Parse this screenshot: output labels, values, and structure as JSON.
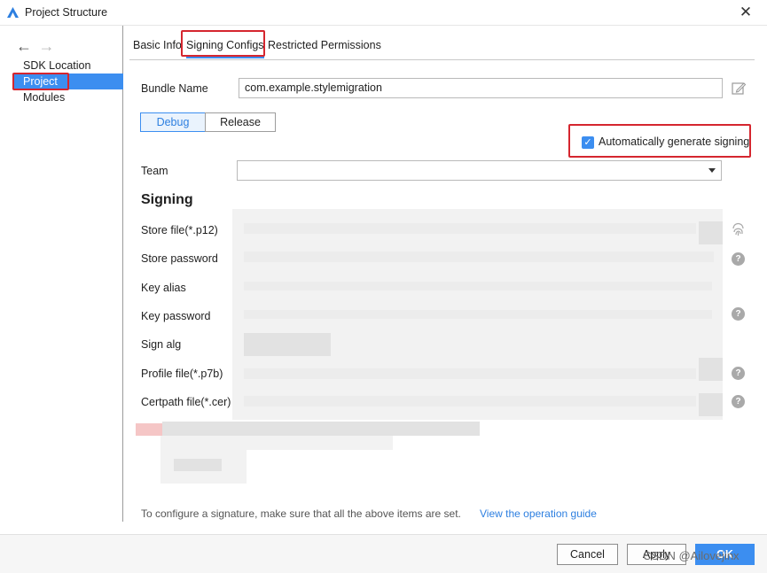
{
  "window": {
    "title": "Project Structure",
    "close_glyph": "✕"
  },
  "sidebar": {
    "back_glyph": "←",
    "forward_glyph": "→",
    "items": [
      {
        "label": "SDK Location"
      },
      {
        "label": "Project",
        "selected": true
      },
      {
        "label": "Modules"
      }
    ]
  },
  "tabs": [
    {
      "label": "Basic Info"
    },
    {
      "label": "Signing Configs",
      "active": true
    },
    {
      "label": "Restricted Permissions"
    }
  ],
  "bundle": {
    "label": "Bundle Name",
    "value": "com.example.stylemigration"
  },
  "modes": {
    "debug": "Debug",
    "release": "Release",
    "active": "Debug"
  },
  "auto_sign": {
    "label": "Automatically generate signing",
    "checked": true,
    "check_glyph": "✓"
  },
  "team": {
    "label": "Team",
    "value": ""
  },
  "signing": {
    "title": "Signing",
    "fields": [
      {
        "label": "Store file(*.p12)"
      },
      {
        "label": "Store password"
      },
      {
        "label": "Key alias"
      },
      {
        "label": "Key password"
      },
      {
        "label": "Sign alg"
      },
      {
        "label": "Profile file(*.p7b)"
      },
      {
        "label": "Certpath file(*.cer)"
      }
    ],
    "help_glyph": "?"
  },
  "footer": {
    "note": "To configure a signature, make sure that all the above items are set.",
    "link": "View the operation guide"
  },
  "buttons": {
    "cancel": "Cancel",
    "apply": "Apply",
    "ok": "OK"
  },
  "watermark": "CSDN @Ailovejinx",
  "colors": {
    "accent": "#3c8ef0",
    "highlight_box": "#d5262f",
    "link": "#2d7fe0"
  }
}
